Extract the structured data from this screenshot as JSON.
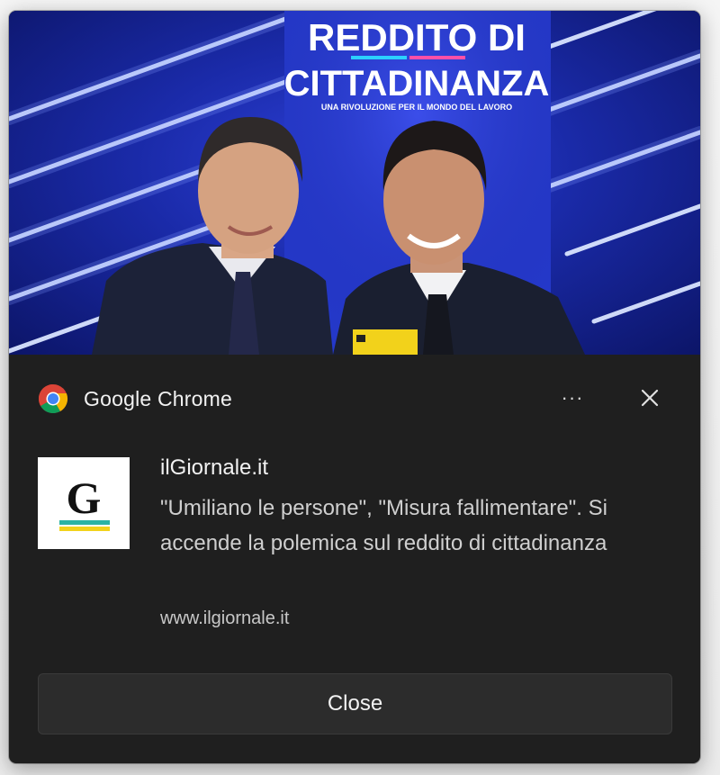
{
  "notification": {
    "app_name": "Google Chrome",
    "app_icon": "chrome-icon",
    "more_icon": "more-horizontal-icon",
    "more_label": "···",
    "close_icon": "close-icon",
    "hero_image": {
      "description_icon": "news-photo",
      "banner_title_line1": "REDDITO DI",
      "banner_title_line2": "CITTADINANZA",
      "banner_tagline": "UNA RIVOLUZIONE PER IL MONDO DEL LAVORO"
    },
    "source": {
      "logo_letter": "G",
      "name": "ilGiornale.it"
    },
    "message": "\"Umiliano le persone\", \"Misura fallimentare\". Si accende la polemica sul reddito di cittadinanza",
    "url": "www.ilgiornale.it",
    "action_label": "Close"
  },
  "colors": {
    "toast_background": "#1f1f1f",
    "button_background": "#2c2c2c",
    "text_primary": "#f2f2f2",
    "hero_blue": "#1a2aa8",
    "logo_underline_teal": "#2bb3a3",
    "logo_underline_yellow": "#f2d21b"
  }
}
